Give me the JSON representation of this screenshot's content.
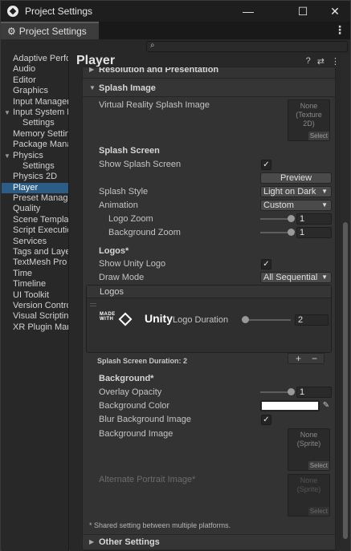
{
  "window": {
    "title": "Project Settings",
    "tab_label": "Project Settings",
    "minimize_icon": "—",
    "maximize_icon": "☐",
    "close_icon": "✕"
  },
  "search": {
    "placeholder": ""
  },
  "sidebar": {
    "items": [
      {
        "label": "Adaptive Performance",
        "sub": false,
        "fold": "",
        "selected": false
      },
      {
        "label": "Audio",
        "sub": false,
        "fold": "",
        "selected": false
      },
      {
        "label": "Editor",
        "sub": false,
        "fold": "",
        "selected": false
      },
      {
        "label": "Graphics",
        "sub": false,
        "fold": "",
        "selected": false
      },
      {
        "label": "Input Manager",
        "sub": false,
        "fold": "",
        "selected": false
      },
      {
        "label": "Input System Package",
        "sub": false,
        "fold": "▼",
        "selected": false
      },
      {
        "label": "Settings",
        "sub": true,
        "fold": "",
        "selected": false
      },
      {
        "label": "Memory Settings",
        "sub": false,
        "fold": "",
        "selected": false
      },
      {
        "label": "Package Manager",
        "sub": false,
        "fold": "",
        "selected": false
      },
      {
        "label": "Physics",
        "sub": false,
        "fold": "▼",
        "selected": false
      },
      {
        "label": "Settings",
        "sub": true,
        "fold": "",
        "selected": false
      },
      {
        "label": "Physics 2D",
        "sub": false,
        "fold": "",
        "selected": false
      },
      {
        "label": "Player",
        "sub": false,
        "fold": "",
        "selected": true
      },
      {
        "label": "Preset Manager",
        "sub": false,
        "fold": "",
        "selected": false
      },
      {
        "label": "Quality",
        "sub": false,
        "fold": "",
        "selected": false
      },
      {
        "label": "Scene Template",
        "sub": false,
        "fold": "",
        "selected": false
      },
      {
        "label": "Script Execution Order",
        "sub": false,
        "fold": "",
        "selected": false
      },
      {
        "label": "Services",
        "sub": false,
        "fold": "",
        "selected": false
      },
      {
        "label": "Tags and Layers",
        "sub": false,
        "fold": "",
        "selected": false
      },
      {
        "label": "TextMesh Pro",
        "sub": false,
        "fold": "",
        "selected": false
      },
      {
        "label": "Time",
        "sub": false,
        "fold": "",
        "selected": false
      },
      {
        "label": "Timeline",
        "sub": false,
        "fold": "",
        "selected": false
      },
      {
        "label": "UI Toolkit",
        "sub": false,
        "fold": "",
        "selected": false
      },
      {
        "label": "Version Control",
        "sub": false,
        "fold": "",
        "selected": false
      },
      {
        "label": "Visual Scripting",
        "sub": false,
        "fold": "",
        "selected": false
      },
      {
        "label": "XR Plugin Management",
        "sub": false,
        "fold": "",
        "selected": false
      }
    ]
  },
  "main": {
    "title": "Player",
    "header_icons": {
      "help": "?",
      "presets": "⇄",
      "menu": "⋮"
    },
    "resolution_header": "Resolution and Presentation",
    "splash": {
      "header": "Splash Image",
      "vr_label": "Virtual Reality Splash Image",
      "vr_value": "None (Texture 2D)",
      "select_label": "Select",
      "screen_heading": "Splash Screen",
      "show_splash_label": "Show Splash Screen",
      "show_splash_checked": "✓",
      "preview_label": "Preview",
      "style_label": "Splash Style",
      "style_value": "Light on Dark",
      "animation_label": "Animation",
      "animation_value": "Custom",
      "logo_zoom_label": "Logo Zoom",
      "logo_zoom_value": "1",
      "bg_zoom_label": "Background Zoom",
      "bg_zoom_value": "1",
      "logos_heading": "Logos*",
      "show_unity_logo_label": "Show Unity Logo",
      "show_unity_logo_checked": "✓",
      "draw_mode_label": "Draw Mode",
      "draw_mode_value": "All Sequential",
      "logos_list_header": "Logos",
      "made_with": "MADE\nWITH",
      "unity_word": "Unity",
      "logo_duration_label": "Logo Duration",
      "logo_duration_value": "2",
      "duration_footer": "Splash Screen Duration: 2",
      "plus": "+",
      "minus": "−",
      "background_heading": "Background*",
      "overlay_opacity_label": "Overlay Opacity",
      "overlay_opacity_value": "1",
      "bg_color_label": "Background Color",
      "bg_color": "#ffffff",
      "blur_label": "Blur Background Image",
      "blur_checked": "✓",
      "bg_image_label": "Background Image",
      "bg_image_value": "None (Sprite)",
      "alt_portrait_label": "Alternate Portrait Image*",
      "alt_portrait_value": "None (Sprite)",
      "shared_note": "* Shared setting between multiple platforms."
    },
    "other_settings_header": "Other Settings"
  },
  "colors": {
    "selection": "#2c5d87",
    "panel": "#333333",
    "background": "#282828"
  }
}
